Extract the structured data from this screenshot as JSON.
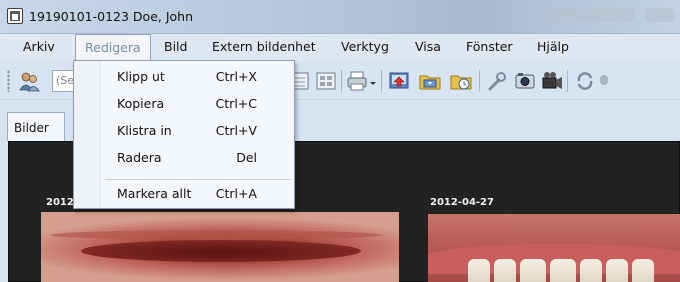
{
  "window": {
    "title": "19190101-0123 Doe, John",
    "app_icon": "app-icon"
  },
  "menubar": {
    "items": [
      {
        "label": "Arkiv"
      },
      {
        "label": "Redigera"
      },
      {
        "label": "Bild"
      },
      {
        "label": "Extern bildenhet"
      },
      {
        "label": "Verktyg"
      },
      {
        "label": "Visa"
      },
      {
        "label": "Fönster"
      },
      {
        "label": "Hjälp"
      }
    ],
    "open_menu": "Redigera"
  },
  "toolbar": {
    "search_placeholder": "(Se",
    "icons": [
      "patients-icon",
      "document-icon",
      "grid-view-icon",
      "print-icon",
      "print-dropdown-icon",
      "export-icon",
      "import-folder-icon",
      "scheduled-folder-icon",
      "wrench-icon",
      "camera-icon",
      "video-camera-icon",
      "refresh-icon"
    ]
  },
  "tabs": [
    {
      "label": "Bilder"
    }
  ],
  "dropdown": {
    "items": [
      {
        "label": "Klipp ut",
        "shortcut": "Ctrl+X"
      },
      {
        "label": "Kopiera",
        "shortcut": "Ctrl+C"
      },
      {
        "label": "Klistra in",
        "shortcut": "Ctrl+V"
      },
      {
        "label": "Radera",
        "shortcut": "Del"
      },
      {
        "label": "Markera allt",
        "shortcut": "Ctrl+A"
      }
    ]
  },
  "content": {
    "photos": [
      {
        "date": "2012"
      },
      {
        "date": "2012-04-27"
      }
    ]
  },
  "colors": {
    "titlebar": "#b7c9de",
    "menubar": "#dfe7f2",
    "content_bg": "#222222",
    "menu_bg": "#f4f7fb"
  }
}
